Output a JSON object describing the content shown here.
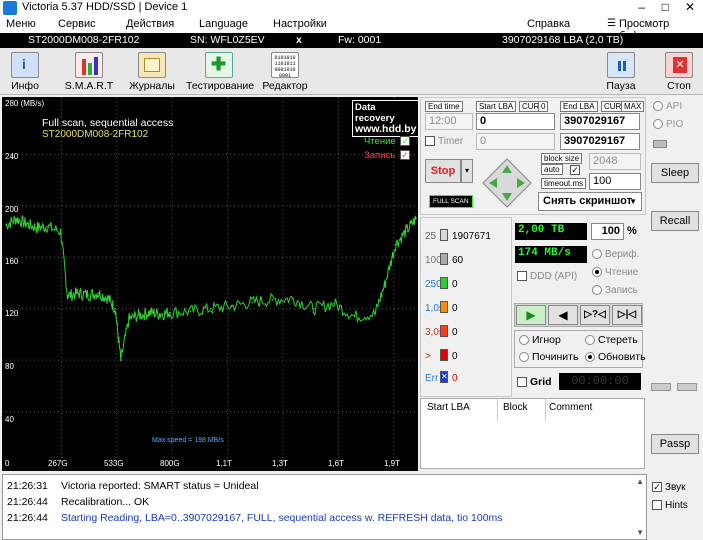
{
  "window": {
    "title": "Victoria 5.37 HDD/SSD | Device 1",
    "buttons": [
      "–",
      "□",
      "✕"
    ]
  },
  "menu": {
    "items": [
      "Меню",
      "Сервис",
      "Действия",
      "Language",
      "Настройки"
    ],
    "help": "Справка",
    "buffer": "Просмотр буфера"
  },
  "info": {
    "model": "ST2000DM008-2FR102",
    "serial": "SN: WFL0Z5EV",
    "close": "x",
    "fw": "Fw: 0001",
    "capacity": "3907029168 LBA (2,0 TB)"
  },
  "toolbar": {
    "info": "Инфо",
    "smart": "S.M.A.R.T",
    "logs": "Журналы",
    "test": "Тестирование",
    "editor": "Редактор",
    "pause": "Пауза",
    "stop": "Стоп"
  },
  "graph": {
    "unit": "280 (MB/s)",
    "title": "Full scan, sequential access",
    "model": "ST2000DM008-2FR102",
    "brand1": "Data recovery",
    "brand2": "www.hdd.by",
    "read": "Чтение",
    "write": "Запись",
    "max_speed": "Max speed = 198 MB/s",
    "y_ticks": [
      "240",
      "200",
      "160",
      "120",
      "80",
      "40"
    ],
    "x_ticks": [
      "0",
      "267G",
      "533G",
      "800G",
      "1,1T",
      "1,3T",
      "1,6T",
      "1,9T"
    ]
  },
  "chart_data": {
    "type": "line",
    "title": "Full scan, sequential access",
    "ylabel": "MB/s",
    "ylim": [
      0,
      280
    ],
    "x_ticks": [
      "0",
      "267G",
      "533G",
      "800G",
      "1,1T",
      "1,3T",
      "1,6T",
      "1,9T"
    ],
    "series": [
      {
        "name": "Чтение",
        "x": [
          0,
          50,
          100,
          150,
          200,
          267,
          300,
          350,
          400,
          450,
          500,
          533,
          560,
          600,
          650,
          700,
          750,
          800,
          900,
          1000,
          1100,
          1200,
          1300,
          1400,
          1500,
          1600,
          1700,
          1800,
          1850,
          1900,
          1950,
          2000
        ],
        "y": [
          185,
          190,
          186,
          183,
          184,
          180,
          130,
          132,
          131,
          132,
          128,
          120,
          80,
          112,
          115,
          117,
          116,
          117,
          118,
          120,
          122,
          125,
          127,
          128,
          120,
          124,
          114,
          116,
          140,
          170,
          180,
          190
        ]
      }
    ]
  },
  "controls": {
    "end_time": "End time",
    "end_time_value": "12:00",
    "timer": "Timer",
    "timer_value": "0",
    "start_lba_label": "Start LBA",
    "start_lba": "0",
    "cur1": "CUR",
    "cur1_value": "0",
    "end_lba_label": "End LBA",
    "end_lba": "3907029167",
    "end_lba2": "3907029167",
    "cur2": "CUR",
    "max": "MAX",
    "stop_button": "Stop",
    "full_scan": "FULL SCAN",
    "block_size": "block size",
    "auto": "auto",
    "block_size_value": "2048",
    "timeout": "timeout.ms",
    "timeout_value": "100",
    "screenshot": "Снять скриншот"
  },
  "stats": {
    "c25": "25",
    "v25": "1907671",
    "c100": "100",
    "v100": "60",
    "c250": "250",
    "v250": "0",
    "c1s": "1,0s",
    "v1s": "0",
    "c3s": "3,0s",
    "v3s": "0",
    "cgt": ">",
    "vgt": "0",
    "cerr": "Err",
    "verr": "0",
    "size": "2,00 TB",
    "percent": "100",
    "pct_sign": "%",
    "speed": "174 MB/s",
    "ddd": "DDD (API)",
    "verify": "Вериф.",
    "read": "Чтение",
    "write": "Запись",
    "ignore": "Игнор",
    "erase": "Стереть",
    "repair": "Починить",
    "refresh": "Обновить",
    "grid": "Grid",
    "timer": "00:00:00"
  },
  "table": {
    "col1": "Start LBA",
    "col2": "Block",
    "col3": "Comment"
  },
  "right": {
    "api": "API",
    "pio": "PIO",
    "sleep": "Sleep",
    "recall": "Recall",
    "passp": "Passp",
    "sound": "Звук",
    "hints": "Hints"
  },
  "log": [
    {
      "time": "21:26:31",
      "text": "Victoria reported: SMART status = Unideal"
    },
    {
      "time": "21:26:44",
      "text": "Recalibration... OK"
    },
    {
      "time": "21:26:44",
      "text": "Starting Reading, LBA=0..3907029167, FULL, sequential access w. REFRESH data, tio 100ms"
    }
  ],
  "colors": {
    "graph_line": "#2fd52f",
    "stats_green": "#2cf52c",
    "accent": "#1a7ad9"
  }
}
